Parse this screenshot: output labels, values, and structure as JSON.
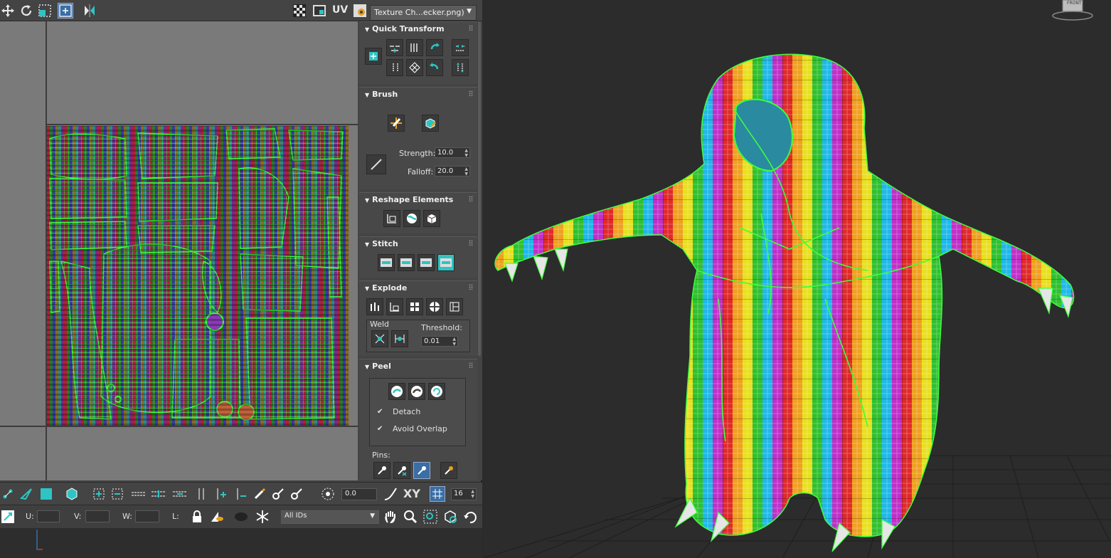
{
  "uv_editor": {
    "uv_label": "UV",
    "texture_dropdown": {
      "selected": "Texture Ch...ecker.png)"
    }
  },
  "panel": {
    "quick_transform": {
      "title": "Quick Transform"
    },
    "brush": {
      "title": "Brush",
      "strength_label": "Strength:",
      "strength_value": "10.0",
      "falloff_label": "Falloff:",
      "falloff_value": "20.0"
    },
    "reshape": {
      "title": "Reshape Elements"
    },
    "stitch": {
      "title": "Stitch"
    },
    "explode": {
      "title": "Explode",
      "weld_label": "Weld",
      "threshold_label": "Threshold:",
      "threshold_value": "0.01"
    },
    "peel": {
      "title": "Peel",
      "detach_label": "Detach",
      "avoid_overlap_label": "Avoid Overlap",
      "pins_label": "Pins:"
    }
  },
  "bottom": {
    "angle_value": "0.0",
    "xy_label": "XY",
    "grid_value": "16",
    "u_label": "U:",
    "v_label": "V:",
    "w_label": "W:",
    "l_label": "L:",
    "ids_dropdown": "All IDs"
  },
  "viewcube": {
    "face_label": "FRONT"
  },
  "colors": {
    "uv_wire": "#3cff3c",
    "accent_teal": "#2ec4c4",
    "panel_bg": "#444444",
    "viewport_bg": "#2c2c2c"
  }
}
